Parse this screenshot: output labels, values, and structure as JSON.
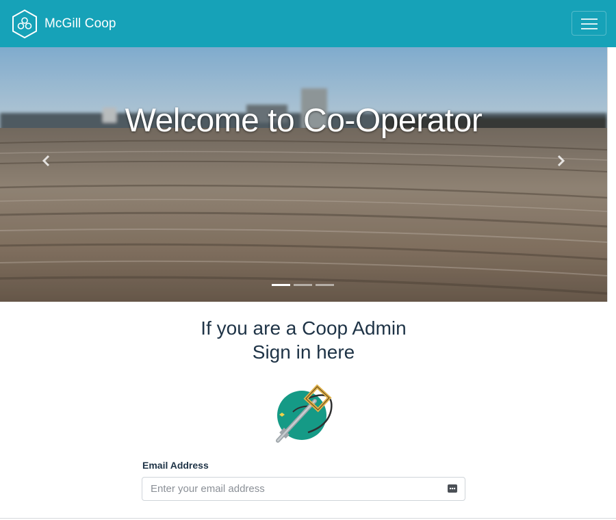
{
  "navbar": {
    "brand_name": "McGill Coop",
    "brand_icon": "hexagon-logo-icon",
    "menu_icon": "hamburger-menu-icon",
    "background": "#16a2b8"
  },
  "carousel": {
    "caption": "Welcome to Co-Operator",
    "prev_icon": "chevron-left-icon",
    "next_icon": "chevron-right-icon",
    "slide_count": 3,
    "active_slide": 1
  },
  "admin": {
    "heading_line1": "If you are a Coop Admin",
    "heading_line2": "Sign in here",
    "icon": "key-icon"
  },
  "form": {
    "email_label": "Email Address",
    "email_placeholder": "Enter your email address",
    "email_value": "",
    "autofill_icon": "password-autofill-icon"
  }
}
